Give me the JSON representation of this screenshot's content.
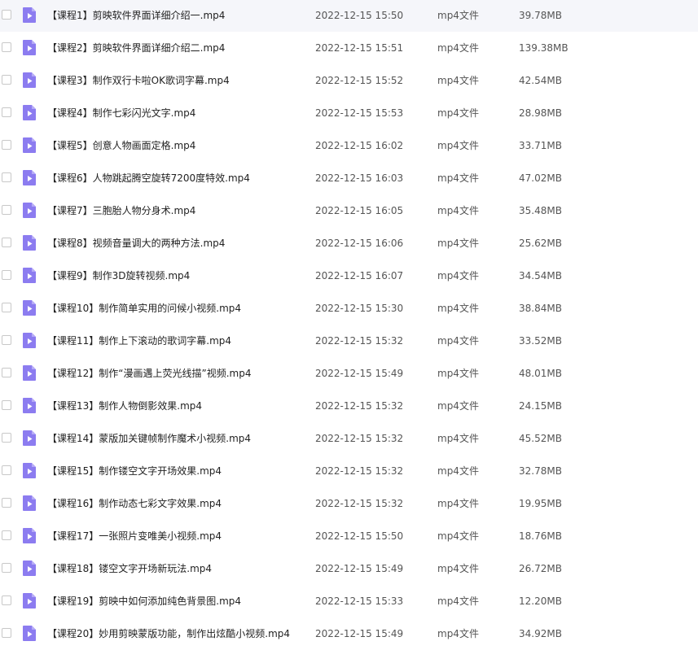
{
  "file_list": {
    "icon": "video-file-icon",
    "icon_color": "#8c7cf0",
    "rows": [
      {
        "name": "【课程1】剪映软件界面详细介绍一.mp4",
        "date": "2022-12-15 15:50",
        "type": "mp4文件",
        "size": "39.78MB"
      },
      {
        "name": "【课程2】剪映软件界面详细介绍二.mp4",
        "date": "2022-12-15 15:51",
        "type": "mp4文件",
        "size": "139.38MB"
      },
      {
        "name": "【课程3】制作双行卡啦OK歌词字幕.mp4",
        "date": "2022-12-15 15:52",
        "type": "mp4文件",
        "size": "42.54MB"
      },
      {
        "name": "【课程4】制作七彩闪光文字.mp4",
        "date": "2022-12-15 15:53",
        "type": "mp4文件",
        "size": "28.98MB"
      },
      {
        "name": "【课程5】创意人物画面定格.mp4",
        "date": "2022-12-15 16:02",
        "type": "mp4文件",
        "size": "33.71MB"
      },
      {
        "name": "【课程6】人物跳起腾空旋转7200度特效.mp4",
        "date": "2022-12-15 16:03",
        "type": "mp4文件",
        "size": "47.02MB"
      },
      {
        "name": "【课程7】三胞胎人物分身术.mp4",
        "date": "2022-12-15 16:05",
        "type": "mp4文件",
        "size": "35.48MB"
      },
      {
        "name": "【课程8】视频音量调大的两种方法.mp4",
        "date": "2022-12-15 16:06",
        "type": "mp4文件",
        "size": "25.62MB"
      },
      {
        "name": "【课程9】制作3D旋转视频.mp4",
        "date": "2022-12-15 16:07",
        "type": "mp4文件",
        "size": "34.54MB"
      },
      {
        "name": "【课程10】制作简单实用的问候小视频.mp4",
        "date": "2022-12-15 15:30",
        "type": "mp4文件",
        "size": "38.84MB"
      },
      {
        "name": "【课程11】制作上下滚动的歌词字幕.mp4",
        "date": "2022-12-15 15:32",
        "type": "mp4文件",
        "size": "33.52MB"
      },
      {
        "name": "【课程12】制作“漫画遇上荧光线描”视频.mp4",
        "date": "2022-12-15 15:49",
        "type": "mp4文件",
        "size": "48.01MB"
      },
      {
        "name": "【课程13】制作人物倒影效果.mp4",
        "date": "2022-12-15 15:32",
        "type": "mp4文件",
        "size": "24.15MB"
      },
      {
        "name": "【课程14】蒙版加关键帧制作魔术小视频.mp4",
        "date": "2022-12-15 15:32",
        "type": "mp4文件",
        "size": "45.52MB"
      },
      {
        "name": "【课程15】制作镂空文字开场效果.mp4",
        "date": "2022-12-15 15:32",
        "type": "mp4文件",
        "size": "32.78MB"
      },
      {
        "name": "【课程16】制作动态七彩文字效果.mp4",
        "date": "2022-12-15 15:32",
        "type": "mp4文件",
        "size": "19.95MB"
      },
      {
        "name": "【课程17】一张照片变唯美小视频.mp4",
        "date": "2022-12-15 15:50",
        "type": "mp4文件",
        "size": "18.76MB"
      },
      {
        "name": "【课程18】镂空文字开场新玩法.mp4",
        "date": "2022-12-15 15:49",
        "type": "mp4文件",
        "size": "26.72MB"
      },
      {
        "name": "【课程19】剪映中如何添加纯色背景图.mp4",
        "date": "2022-12-15 15:33",
        "type": "mp4文件",
        "size": "12.20MB"
      },
      {
        "name": "【课程20】妙用剪映蒙版功能，制作出炫酷小视频.mp4",
        "date": "2022-12-15 15:49",
        "type": "mp4文件",
        "size": "34.92MB"
      }
    ]
  }
}
